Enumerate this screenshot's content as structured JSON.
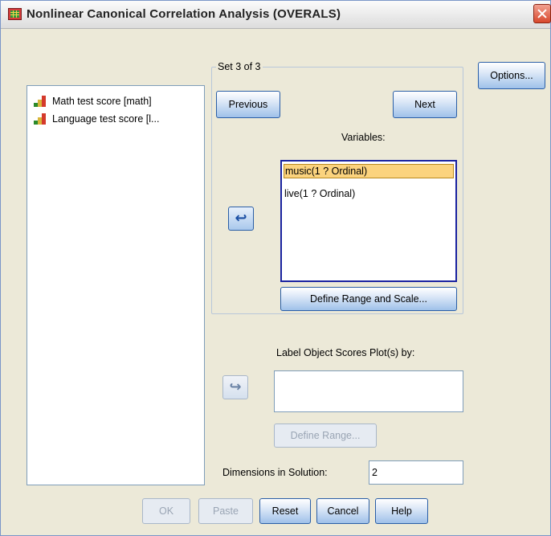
{
  "window": {
    "title": "Nonlinear Canonical Correlation Analysis (OVERALS)"
  },
  "source_list": {
    "items": [
      {
        "label": "Math test score [math]",
        "icon": "scale-variable-icon"
      },
      {
        "label": "Language test score [l...",
        "icon": "scale-variable-icon"
      }
    ]
  },
  "set_group": {
    "label": "Set 3 of 3",
    "previous_label": "Previous",
    "next_label": "Next",
    "variables_label": "Variables:",
    "variables": [
      {
        "label": "music(1 ? Ordinal)",
        "selected": true
      },
      {
        "label": "live(1 ? Ordinal)",
        "selected": false
      }
    ],
    "define_range_scale_label": "Define Range and Scale..."
  },
  "options_label": "Options...",
  "label_plots": {
    "label": "Label Object Scores Plot(s) by:",
    "value": "",
    "define_range_label": "Define Range..."
  },
  "dimensions": {
    "label": "Dimensions in Solution:",
    "value": "2"
  },
  "footer": {
    "ok_label": "OK",
    "paste_label": "Paste",
    "reset_label": "Reset",
    "cancel_label": "Cancel",
    "help_label": "Help"
  },
  "colors": {
    "selection": "#fbd37e",
    "dialog_bg": "#ece9d8",
    "focus_border": "#1a23a0"
  }
}
